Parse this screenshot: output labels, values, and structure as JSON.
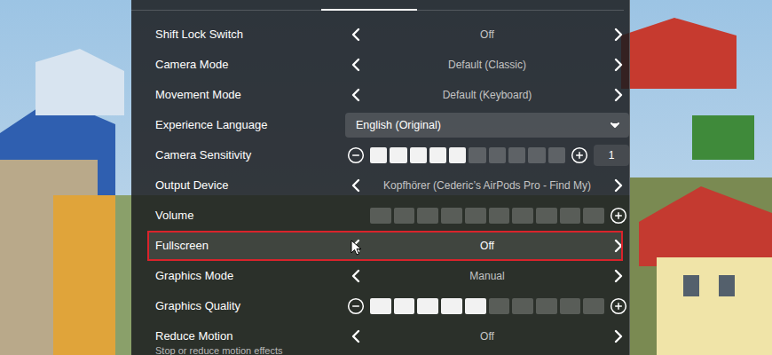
{
  "tabs": [
    {
      "selected": false
    },
    {
      "selected": true
    },
    {
      "selected": false
    }
  ],
  "settings": [
    {
      "kind": "selector",
      "label": "Shift Lock Switch",
      "value": "Off",
      "hovered": false,
      "annotated": false
    },
    {
      "kind": "selector",
      "label": "Camera Mode",
      "value": "Default (Classic)",
      "hovered": false,
      "annotated": false
    },
    {
      "kind": "selector",
      "label": "Movement Mode",
      "value": "Default (Keyboard)",
      "hovered": false,
      "annotated": false
    },
    {
      "kind": "dropdown",
      "label": "Experience Language",
      "value": "English (Original)",
      "hovered": false,
      "annotated": false
    },
    {
      "kind": "slider",
      "label": "Camera Sensitivity",
      "level": 0.5,
      "min_button": true,
      "reading": "1",
      "hovered": false,
      "annotated": false
    },
    {
      "kind": "selector",
      "label": "Output Device",
      "value": "Kopfhörer (Cederic’s AirPods Pro - Find My)",
      "hovered": false,
      "annotated": false
    },
    {
      "kind": "slider",
      "label": "Volume",
      "level": 0,
      "min_button": false,
      "hovered": false,
      "annotated": false
    },
    {
      "kind": "selector",
      "label": "Fullscreen",
      "value": "Off",
      "hovered": true,
      "annotated": true
    },
    {
      "kind": "selector",
      "label": "Graphics Mode",
      "value": "Manual",
      "hovered": false,
      "annotated": false
    },
    {
      "kind": "slider",
      "label": "Graphics Quality",
      "level": 0.5,
      "min_button": true,
      "hovered": false,
      "annotated": false
    },
    {
      "kind": "selector",
      "label": "Reduce Motion",
      "description": "Stop or reduce motion effects",
      "value": "Off",
      "hovered": false,
      "annotated": false
    }
  ]
}
